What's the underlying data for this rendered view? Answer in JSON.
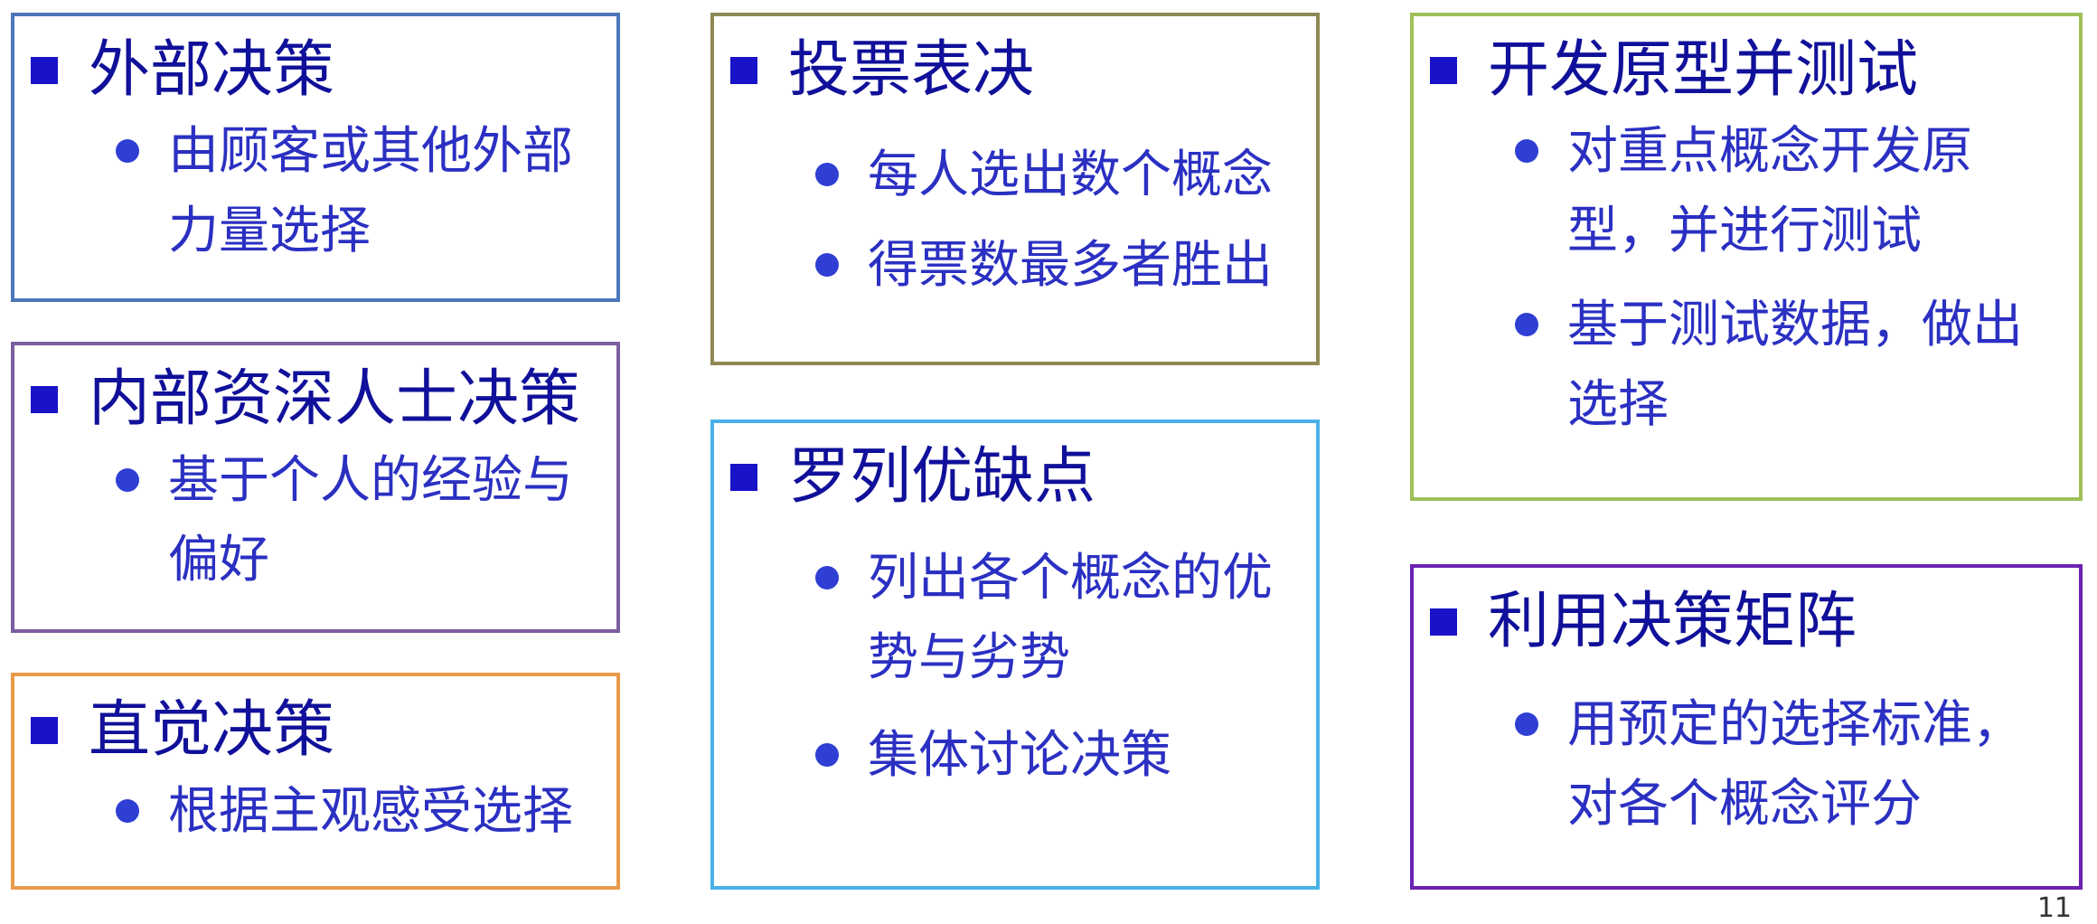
{
  "colors": {
    "title_text": "#10109a",
    "item_text": "#2b30c2",
    "square_bullet": "#1a12c8",
    "round_bullet": "#2f3fd4",
    "border_external": "#4d77b8",
    "border_internal": "#7b5e9f",
    "border_intuition": "#e89a4a",
    "border_voting": "#8f8955",
    "border_pros_cons": "#49b1e8",
    "border_prototype": "#9fbf5a",
    "border_matrix": "#6b22b0"
  },
  "icons": {
    "title_bullet": "square-bullet-icon",
    "item_bullet": "round-bullet-icon"
  },
  "cards": {
    "external": {
      "title": "外部决策",
      "items": [
        "由顾客或其他外部力量选择"
      ]
    },
    "internal": {
      "title": "内部资深人士决策",
      "items": [
        "基于个人的经验与偏好"
      ]
    },
    "intuition": {
      "title": "直觉决策",
      "items": [
        "根据主观感受选择"
      ]
    },
    "voting": {
      "title": "投票表决",
      "items": [
        "每人选出数个概念",
        "得票数最多者胜出"
      ]
    },
    "pros_cons": {
      "title": "罗列优缺点",
      "items": [
        "列出各个概念的优势与劣势",
        "集体讨论决策"
      ]
    },
    "prototype": {
      "title": "开发原型并测试",
      "items": [
        "对重点概念开发原型，并进行测试",
        "基于测试数据，做出选择"
      ]
    },
    "matrix": {
      "title": "利用决策矩阵",
      "items": [
        "用预定的选择标准，对各个概念评分"
      ]
    }
  },
  "page_mark": "11"
}
